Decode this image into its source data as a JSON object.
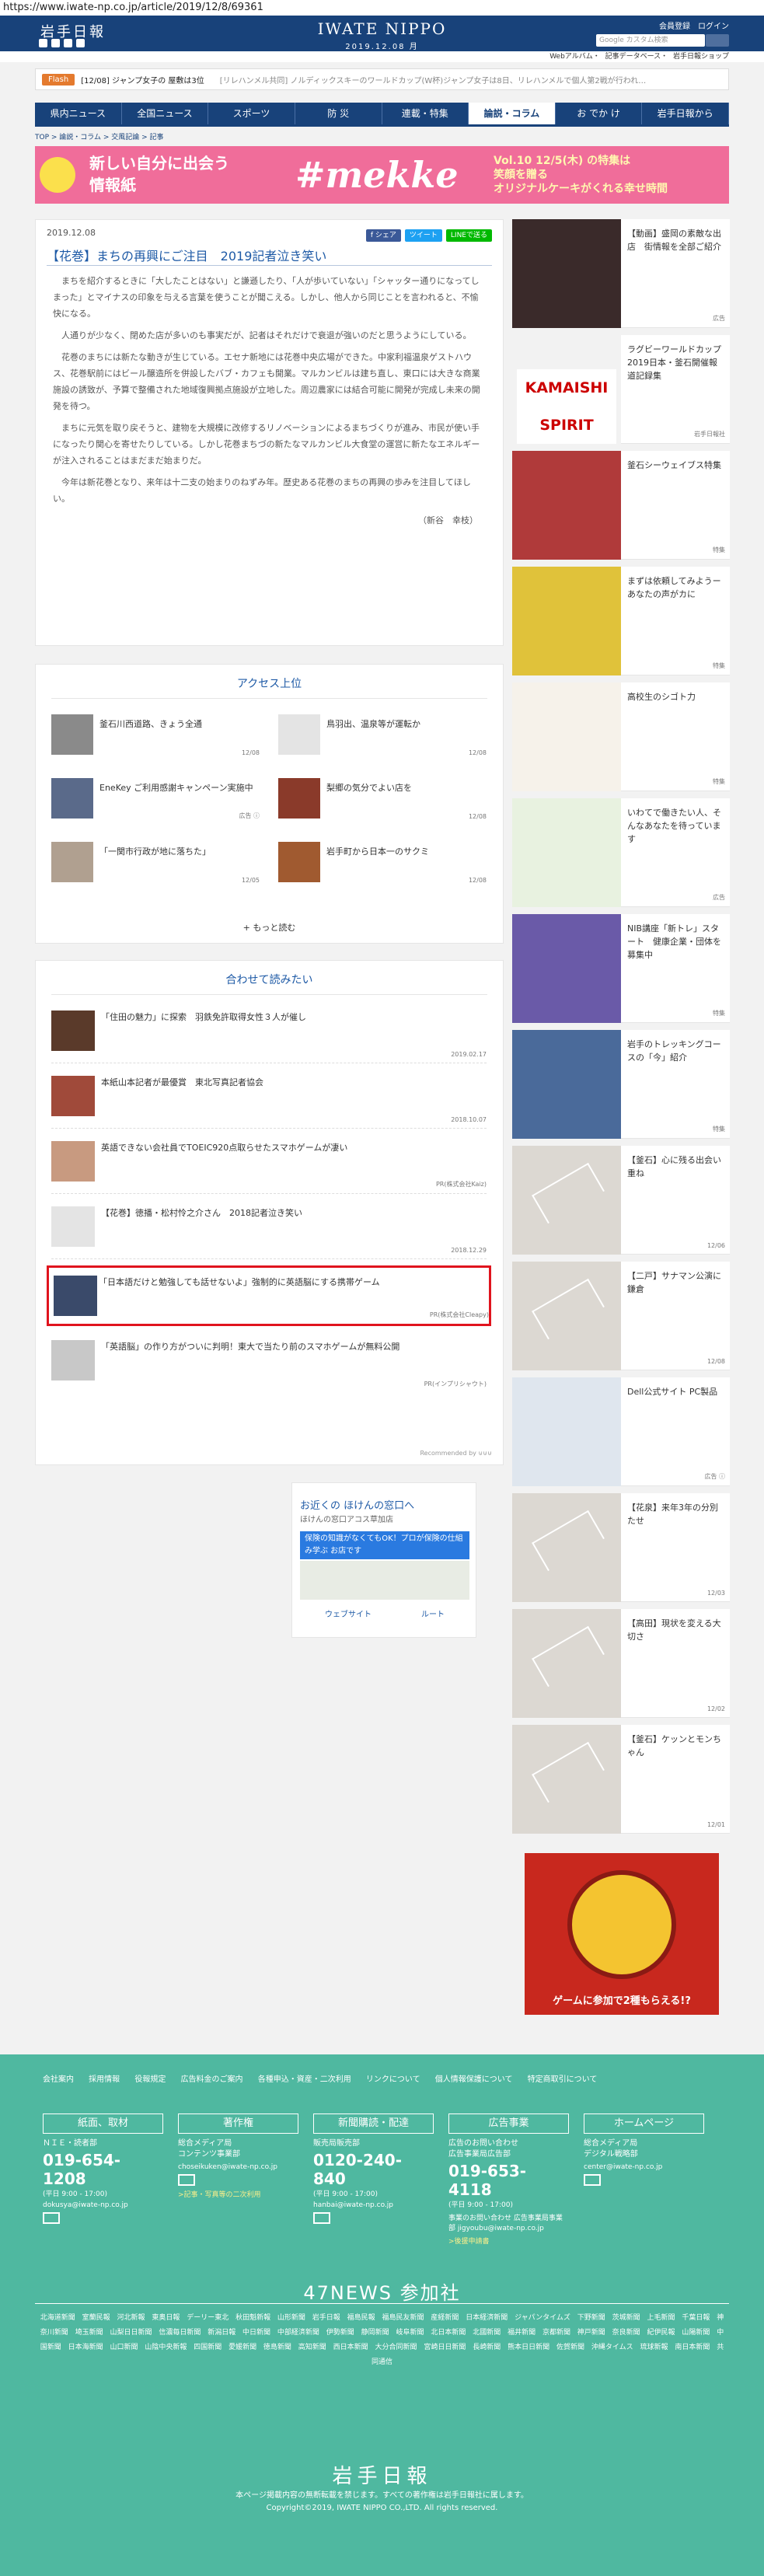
{
  "url": "https://www.iwate-np.co.jp/article/2019/12/8/69361",
  "header": {
    "logo": "岩手日報",
    "brand": "IWATE NIPPO",
    "date": "2019.12.08 月",
    "login": [
      "会員登録",
      "ログイン"
    ],
    "search_placeholder": "Google カスタム検索",
    "links": "Webアルバム・ 記事データベース・ 岩手日報ショップ"
  },
  "flash": {
    "tag": "Flash",
    "t1": "[12/08] ジャンプ女子の 屋敷は3位",
    "t2": "[リレハンメル共同] ノルディックスキーのワールドカップ(W杯)ジャンプ女子は8日、リレハンメルで個人第2戦が行われ…"
  },
  "nav": [
    "県内ニュース",
    "全国ニュース",
    "スポーツ",
    "防 災",
    "連載・特集",
    "論説・コラム",
    "お でか け",
    "岩手日報から"
  ],
  "breadcrumb": "TOP > 論説・コラム > 交風記論 > 記事",
  "banner": {
    "b1": "新しい自分に出会う\n情報紙",
    "b2": "#mekke",
    "b3": "Vol.10 12/5(木) の特集は\n笑顔を贈る\nオリジナルケーキがくれる幸せ時間"
  },
  "article": {
    "date": "2019.12.08",
    "share": [
      "f シェア",
      "ツイート",
      "LINEで送る"
    ],
    "title": "【花巻】まちの再興にご注目　2019記者泣き笑い",
    "paras": [
      "まちを紹介するときに「大したことはない」と謙遜したり、「人が歩いていない」「シャッター通りになってしまった」とマイナスの印象を与える言葉を使うことが聞こえる。しかし、他人から同じことを言われると、不愉快になる。",
      "人通りが少なく、閉めた店が多いのも事実だが、記者はそれだけで衰退が強いのだと思うようにしている。",
      "花巻のまちには新たな動きが生じている。エセナ新地には花巻中央広場ができた。中家利福温泉ゲストハウス、花巻駅前にはビール醸造所を併設したバブ・カフェも開業。マルカンビルは建ち直し、東口には大きな商業施設の誘致が、予算で整備された地域復興拠点施設が立地した。周辺農家には結合可能に開発が完成し未来の開発を待つ。",
      "まちに元気を取り戻そうと、建物を大規模に改修するリノベーションによるまちづくりが進み、市民が使い手になったり関心を寄せたりしている。しかし花巻まちづの新たなマルカンビル大食堂の運営に新たなエネルギーが注入されることはまだまだ始まりだ。",
      "今年は新花巻となり、来年は十二支の始まりのねずみ年。歴史ある花巻のまちの再興の歩みを注目してほしい。"
    ],
    "sig": "（新谷　幸枝）"
  },
  "access": {
    "title": "アクセス上位",
    "items": [
      {
        "t": "釜石川西道路、きょう全通",
        "d": "12/08"
      },
      {
        "t": "鳥羽出、温泉等が運転か",
        "d": "12/08"
      },
      {
        "t": "EneKey ご利用感謝キャンペーン実施中",
        "d": "広告 ⓘ"
      },
      {
        "t": "梨郷の気分でよい店を",
        "d": "12/08"
      },
      {
        "t": "「一関市行政が地に落ちた」",
        "d": "12/05"
      },
      {
        "t": "岩手町から日本一のサクミ",
        "d": "12/08"
      }
    ],
    "more": "+ もっと読む"
  },
  "related": {
    "title": "合わせて読みたい",
    "items": [
      {
        "t": "「住田の魅力」に探索　羽鉄免許取得女性３人が催し",
        "d": "2019.02.17"
      },
      {
        "t": "本紙山本記者が最優賞　東北写真記者協会",
        "d": "2018.10.07"
      },
      {
        "t": "英語できない会社員でTOEIC920点取らせたスマホゲームが凄い",
        "d": "PR(株式会社Kaiz)"
      },
      {
        "t": "【花巻】徳播・松村怜之介さん　2018記者泣き笑い",
        "d": "2018.12.29"
      },
      {
        "t": "「日本語だけと勉強しても話せないよ」強制的に英語脳にする携帯ゲーム",
        "d": "PR(株式会社Cleapy)"
      },
      {
        "t": "「英語脳」の作り方がついに判明！東大で当たり前のスマホゲームが無料公開",
        "d": "PR(インプリシャウト)"
      }
    ],
    "rec": "Recommended by ⊍⊍⊍"
  },
  "ad": {
    "a1": "お近くの ほけんの窓口へ",
    "a2": "ほけんの窓口アコス草加店",
    "a3": "保険の知識がなくてもOK！プロが保険の仕組み学ぶ お店です",
    "btns": [
      "ウェブサイト",
      "ルート"
    ]
  },
  "side": [
    {
      "t": "【動画】盛岡の素敵な出店　街情報を全部ご紹介",
      "l": "広告"
    },
    {
      "t": "ラグビーワールドカップ2019日本・釜石開催報道記録集",
      "l": "岩手日報社"
    },
    {
      "t": "釜石シーウェイブス特集",
      "l": "特集"
    },
    {
      "t": "まずは依頼してみようーあなたの声がカに",
      "l": "特集"
    },
    {
      "t": "高校生のシゴト力",
      "l": "特集"
    },
    {
      "t": "いわてで働きたい人、そんなあなたを待っています",
      "l": "広告"
    },
    {
      "t": "NIB講座「新トレ」スタート　健康企業・団体を募集中",
      "l": "特集"
    },
    {
      "t": "岩手のトレッキングコースの「今」紹介",
      "l": "特集"
    },
    {
      "t": "【釜石】心に残る出会い重ね",
      "l": "12/06"
    },
    {
      "t": "【二戸】サナマン公演に鎌倉",
      "l": "12/08"
    },
    {
      "t": "Dell公式サイト PC製品",
      "l": "広告 ⓘ"
    },
    {
      "t": "【花泉】来年3年の分別たせ",
      "l": "12/03"
    },
    {
      "t": "【高田】現状を変える大切さ",
      "l": "12/02"
    },
    {
      "t": "【釜石】ケッンとモンちゃん",
      "l": "12/01"
    }
  ],
  "roulette": "ゲームに参加で2種もらえる!?",
  "footer": {
    "links": "会社案内 採用情報 役報規定 広告料金のご案内 各種申込・資産・二次利用 リンクについて 個人情報保護について 特定商取引について",
    "cols": [
      {
        "h": "紙面、取材",
        "l": "ＮＩＥ・読者部",
        "n": "019-654-1208",
        "s": "(平日 9:00 - 17:00)",
        "m": "dokusya@iwate-np.co.jp",
        "k": ""
      },
      {
        "h": "著作権",
        "l": "総合メディア局\nコンテンツ事業部",
        "n": "",
        "s": "",
        "m": "choseikuken@iwate-np.co.jp",
        "k": ">記事・写真等の二次利用"
      },
      {
        "h": "新聞購読・配達",
        "l": "販売局販売部",
        "n": "0120-240-840",
        "s": "(平日 9:00 - 17:00)",
        "m": "hanbai@iwate-np.co.jp",
        "k": ""
      },
      {
        "h": "広告事業",
        "l": "広告のお問い合わせ\n広告事業局広告部",
        "n": "019-653-4118",
        "s": "(平日 9:00 - 17:00)",
        "m": "事業のお問い合わせ 広告事業局事業部 jigyoubu@iwate-np.co.jp",
        "k": ">後援申請書"
      },
      {
        "h": "ホームページ",
        "l": "総合メディア局\nデジタル戦略部",
        "n": "",
        "s": "",
        "m": "center@iwate-np.co.jp",
        "k": ""
      }
    ],
    "f47": "47NEWS 参加社",
    "papers": "北海道新聞 室蘭民報 河北新報 東奥日報 デーリー東北 秋田魁新報 山形新聞 岩手日報 福島民報 福島民友新聞 産経新聞 日本経済新聞 ジャパンタイムズ 下野新聞 茨城新聞 上毛新聞 千葉日報 神奈川新聞 埼玉新聞 山梨日日新聞 信濃毎日新聞 新潟日報 中日新聞 中部経済新聞 伊勢新聞 静岡新聞 岐阜新聞 北日本新聞 北國新聞 福井新聞 京都新聞 神戸新聞 奈良新聞 紀伊民報 山陽新聞 中国新聞 日本海新聞 山口新聞 山陰中央新報 四国新聞 愛媛新聞 徳島新聞 高知新聞 西日本新聞 大分合同新聞 宮崎日日新聞 長崎新聞 熊本日日新聞 佐賀新聞 沖縄タイムス 琉球新報 南日本新聞 共同通信",
    "logo": "岩手日報",
    "c1": "本ページ掲載内容の無断転載を禁じます。すべての著作権は岩手日報社に属します。",
    "c2": "Copyright©2019, IWATE NIPPO CO.,LTD. All rights reserved."
  }
}
